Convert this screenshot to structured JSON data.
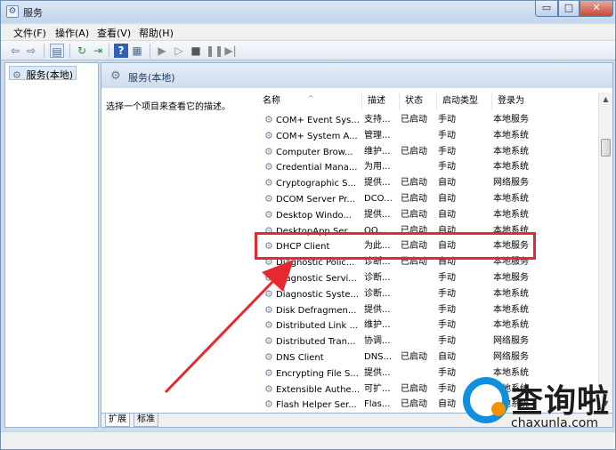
{
  "window": {
    "title": "服务",
    "min_label": "▭",
    "max_label": "□",
    "close_label": "✕"
  },
  "menu": [
    "文件(F)",
    "操作(A)",
    "查看(V)",
    "帮助(H)"
  ],
  "tree": {
    "item": "服务(本地)"
  },
  "pane": {
    "title": "服务(本地)",
    "description": "选择一个项目来查看它的描述。"
  },
  "columns": [
    "名称",
    "描述",
    "状态",
    "启动类型",
    "登录为"
  ],
  "services": [
    {
      "name": "COM+ Event Sys...",
      "desc": "支持...",
      "status": "已启动",
      "startup": "手动",
      "logon": "本地服务"
    },
    {
      "name": "COM+ System A...",
      "desc": "管理...",
      "status": "",
      "startup": "手动",
      "logon": "本地系统"
    },
    {
      "name": "Computer Brow...",
      "desc": "维护...",
      "status": "已启动",
      "startup": "手动",
      "logon": "本地系统"
    },
    {
      "name": "Credential Mana...",
      "desc": "为用...",
      "status": "",
      "startup": "手动",
      "logon": "本地系统"
    },
    {
      "name": "Cryptographic S...",
      "desc": "提供...",
      "status": "已启动",
      "startup": "自动",
      "logon": "网络服务"
    },
    {
      "name": "DCOM Server Pr...",
      "desc": "DCO...",
      "status": "已启动",
      "startup": "自动",
      "logon": "本地系统"
    },
    {
      "name": "Desktop Windo...",
      "desc": "提供...",
      "status": "已启动",
      "startup": "自动",
      "logon": "本地系统"
    },
    {
      "name": "DesktopApp Ser...",
      "desc": "QQ...",
      "status": "已启动",
      "startup": "自动",
      "logon": "本地系统"
    },
    {
      "name": "DHCP Client",
      "desc": "为此...",
      "status": "已启动",
      "startup": "自动",
      "logon": "本地服务"
    },
    {
      "name": "Diagnostic Polic...",
      "desc": "诊断...",
      "status": "已启动",
      "startup": "自动",
      "logon": "本地服务"
    },
    {
      "name": "Diagnostic Servi...",
      "desc": "诊断...",
      "status": "",
      "startup": "手动",
      "logon": "本地服务"
    },
    {
      "name": "Diagnostic Syste...",
      "desc": "诊断...",
      "status": "",
      "startup": "手动",
      "logon": "本地系统"
    },
    {
      "name": "Disk Defragmen...",
      "desc": "提供...",
      "status": "",
      "startup": "手动",
      "logon": "本地系统"
    },
    {
      "name": "Distributed Link ...",
      "desc": "维护...",
      "status": "",
      "startup": "手动",
      "logon": "本地系统"
    },
    {
      "name": "Distributed Tran...",
      "desc": "协调...",
      "status": "",
      "startup": "手动",
      "logon": "网络服务"
    },
    {
      "name": "DNS Client",
      "desc": "DNS...",
      "status": "已启动",
      "startup": "自动",
      "logon": "网络服务"
    },
    {
      "name": "Encrypting File S...",
      "desc": "提供...",
      "status": "",
      "startup": "手动",
      "logon": "本地系统"
    },
    {
      "name": "Extensible Authe...",
      "desc": "可扩...",
      "status": "已启动",
      "startup": "手动",
      "logon": "本地系统"
    },
    {
      "name": "Flash Helper Ser...",
      "desc": "Flas...",
      "status": "已启动",
      "startup": "自动",
      "logon": "本地系统"
    }
  ],
  "tabs": [
    "扩展",
    "标准"
  ],
  "watermark": {
    "brand": "查询啦",
    "url": "chaxunla.com"
  },
  "colors": {
    "highlight": "#e6282f",
    "arrow": "#e6282f",
    "brand_blue": "#0f8fde",
    "brand_orange": "#f29200"
  }
}
